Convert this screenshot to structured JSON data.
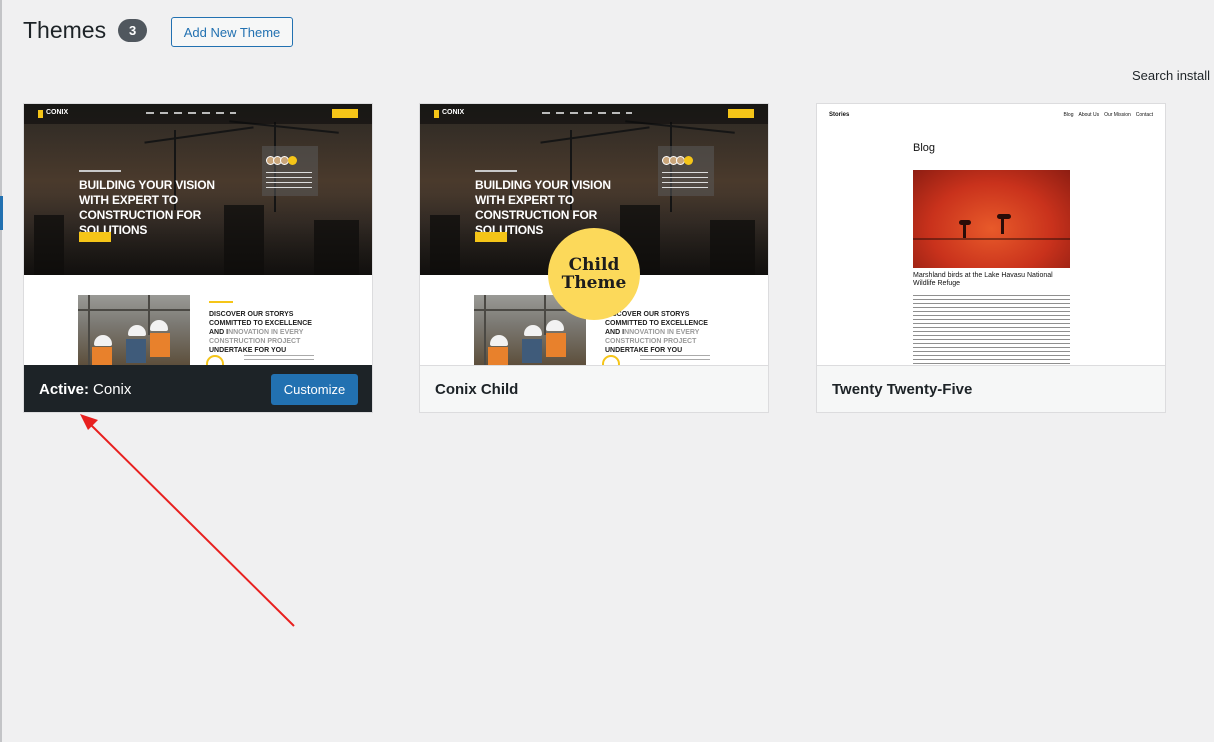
{
  "header": {
    "title": "Themes",
    "count": "3",
    "add_new_label": "Add New Theme",
    "search_label": "Search install"
  },
  "themes": [
    {
      "name": "Conix",
      "active_label": "Active:",
      "action_label": "Customize",
      "preview": {
        "logo": "CONIX",
        "hero_title": "BUILDING YOUR VISION WITH EXPERT TO CONSTRUCTION FOR SOLUTIONS",
        "section_title": "DISCOVER OUR STORYS COMMITTED TO EXCELLENCE AND I",
        "section_title_muted": "NNOVATION IN EVERY CONSTRUCTION PROJECT",
        "section_title_end": "UNDERTAKE FOR YOU"
      }
    },
    {
      "name": "Conix Child",
      "badge": [
        "Child",
        "Theme"
      ],
      "preview": {
        "logo": "CONIX",
        "hero_title": "BUILDING YOUR VISION WITH EXPERT TO CONSTRUCTION FOR SOLUTIONS",
        "section_title": "DISCOVER OUR STORYS COMMITTED TO EXCELLENCE AND I",
        "section_title_muted": "NNOVATION IN EVERY CONSTRUCTION PROJECT",
        "section_title_end": "UNDERTAKE FOR YOU"
      }
    },
    {
      "name": "Twenty Twenty-Five",
      "preview": {
        "brand": "Stories",
        "nav": [
          "Blog",
          "About Us",
          "Our Mission",
          "Contact"
        ],
        "heading": "Blog",
        "caption": "Marshland birds at the Lake Havasu National Wildlife Refuge"
      }
    }
  ],
  "colors": {
    "accent": "#2271b1",
    "active_bar": "#1d2327",
    "badge_yellow": "#fcd95a",
    "annotation_arrow": "#e8201f"
  }
}
